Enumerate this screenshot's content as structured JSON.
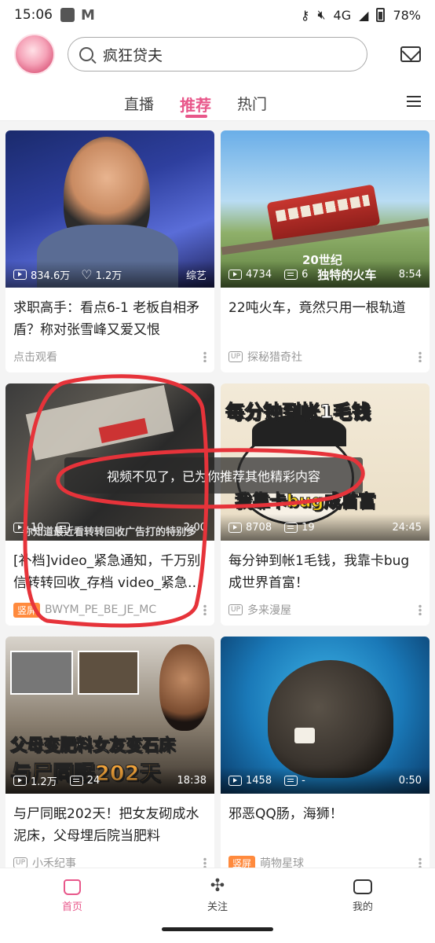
{
  "status": {
    "time": "15:06",
    "network": "4G",
    "battery": "78%"
  },
  "header": {
    "search_text": "疯狂贷夫"
  },
  "tabs": [
    {
      "label": "直播"
    },
    {
      "label": "推荐"
    },
    {
      "label": "热门"
    }
  ],
  "cards": [
    {
      "views": "834.6万",
      "likes": "1.2万",
      "badge": "综艺",
      "title": "求职高手：看点6-1 老板自相矛盾？称对张雪峰又爱又恨",
      "meta": "点击观看"
    },
    {
      "views": "4734",
      "danmaku": "6",
      "duration": "8:54",
      "cover_line1": "20世纪",
      "cover_line2": "独特的火车",
      "title": "22吨火车，竟然只用一根轨道",
      "meta": "探秘猎奇社"
    },
    {
      "views": "10",
      "danmaku": "",
      "duration": "2:00",
      "cover_text": "你知道最近看转转回收广告打的特别多",
      "title": "[补档]video_紧急通知，千万别信转转回收_存档 video_紧急通知，千万别信转转回收",
      "tag": "竖屏",
      "meta": "BWYM_PE_BE_JE_MC"
    },
    {
      "views": "8708",
      "danmaku": "19",
      "duration": "24:45",
      "cover_line1": "每分钟到帐1毛钱",
      "cover_line2": "我靠卡bug成首富",
      "title": "每分钟到帐1毛钱，我靠卡bug成世界首富！",
      "meta": "多来漫屋"
    },
    {
      "views": "1.2万",
      "danmaku": "24",
      "duration": "18:38",
      "cover_line1": "父母变肥料女友变石床",
      "cover_line2": "与尸同眠202天",
      "title": "与尸同眠202天！把女友砌成水泥床，父母埋后院当肥料",
      "meta": "小禾纪事"
    },
    {
      "views": "1458",
      "danmaku": "-",
      "duration": "0:50",
      "title": "邪恶QQ肠，海狮！",
      "tag": "竖屏",
      "meta": "萌物星球"
    }
  ],
  "popup": {
    "text": "视频不见了，已为你推荐其他精彩内容"
  },
  "nav": [
    {
      "label": "首页"
    },
    {
      "label": "关注"
    },
    {
      "label": "我的"
    }
  ]
}
